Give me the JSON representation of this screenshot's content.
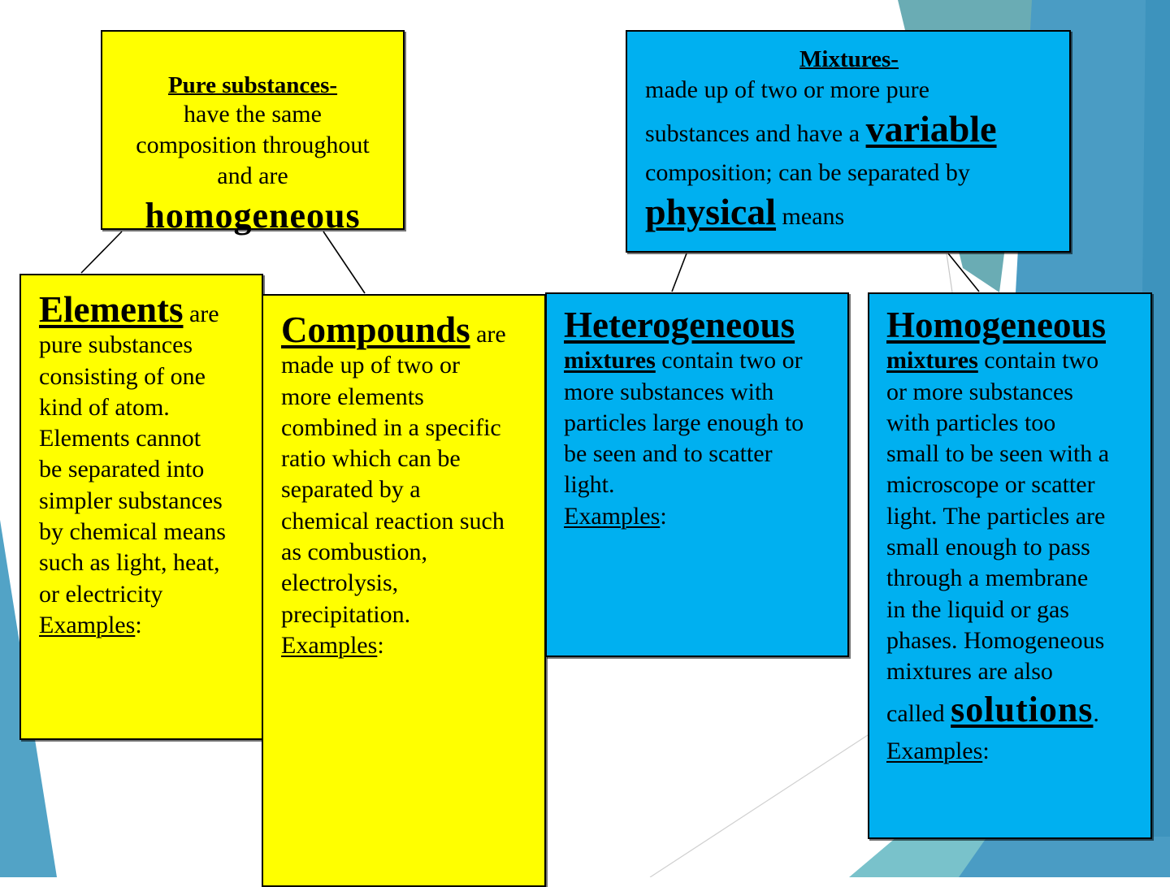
{
  "slide": {
    "theme_colors": {
      "yellow_box": "#ffff00",
      "blue_box": "#00b0f0",
      "accent_teal": "#6aacb4",
      "accent_blue": "#4a9cc4"
    }
  },
  "pure_substances": {
    "title": "Pure substances-",
    "lines": [
      "have the same",
      "composition throughout",
      "and are"
    ],
    "emphasis": "homogeneous"
  },
  "mixtures": {
    "title": "Mixtures-",
    "line1": "made up of two or more pure",
    "line2_prefix": "substances and have a ",
    "line2_emphasis": "variable",
    "line3": "composition; can be separated by",
    "line4_emphasis": "physical",
    "line4_suffix": " means"
  },
  "elements": {
    "heading": "Elements",
    "heading_suffix": " are",
    "body_lines": [
      "pure substances",
      "consisting of one",
      "kind of atom.",
      "Elements cannot",
      "be separated into",
      "simpler substances",
      "by chemical means",
      "such as light, heat,",
      "or electricity"
    ],
    "examples_label": "Examples",
    "examples_colon": ":"
  },
  "compounds": {
    "heading": "Compounds",
    "heading_suffix": " are",
    "body_lines": [
      "made up of two or",
      "more elements",
      "combined in a specific",
      "ratio which can be",
      "separated by a",
      "chemical reaction such",
      "as combustion,",
      "electrolysis,",
      "precipitation."
    ],
    "examples_label": "Examples",
    "examples_colon": ":"
  },
  "heterogeneous": {
    "heading": "Heterogeneous",
    "subheading": "mixtures",
    "subheading_suffix": " contain two or",
    "body_lines": [
      "more substances with",
      "particles large enough to",
      "be seen and to scatter",
      "light."
    ],
    "examples_label": "Examples",
    "examples_colon": ":"
  },
  "homogeneous": {
    "heading": "Homogeneous",
    "subheading": "mixtures",
    "subheading_suffix": " contain two",
    "body_lines": [
      "or more substances",
      "with particles too",
      "small to be seen with a",
      "microscope or scatter",
      "light. The particles are",
      "small enough to pass",
      "through a membrane",
      "in the liquid or gas",
      "phases. Homogeneous",
      "mixtures are also"
    ],
    "final_prefix": "called ",
    "final_emphasis": "solutions",
    "final_suffix": ".",
    "examples_label": "Examples",
    "examples_colon": ":"
  }
}
